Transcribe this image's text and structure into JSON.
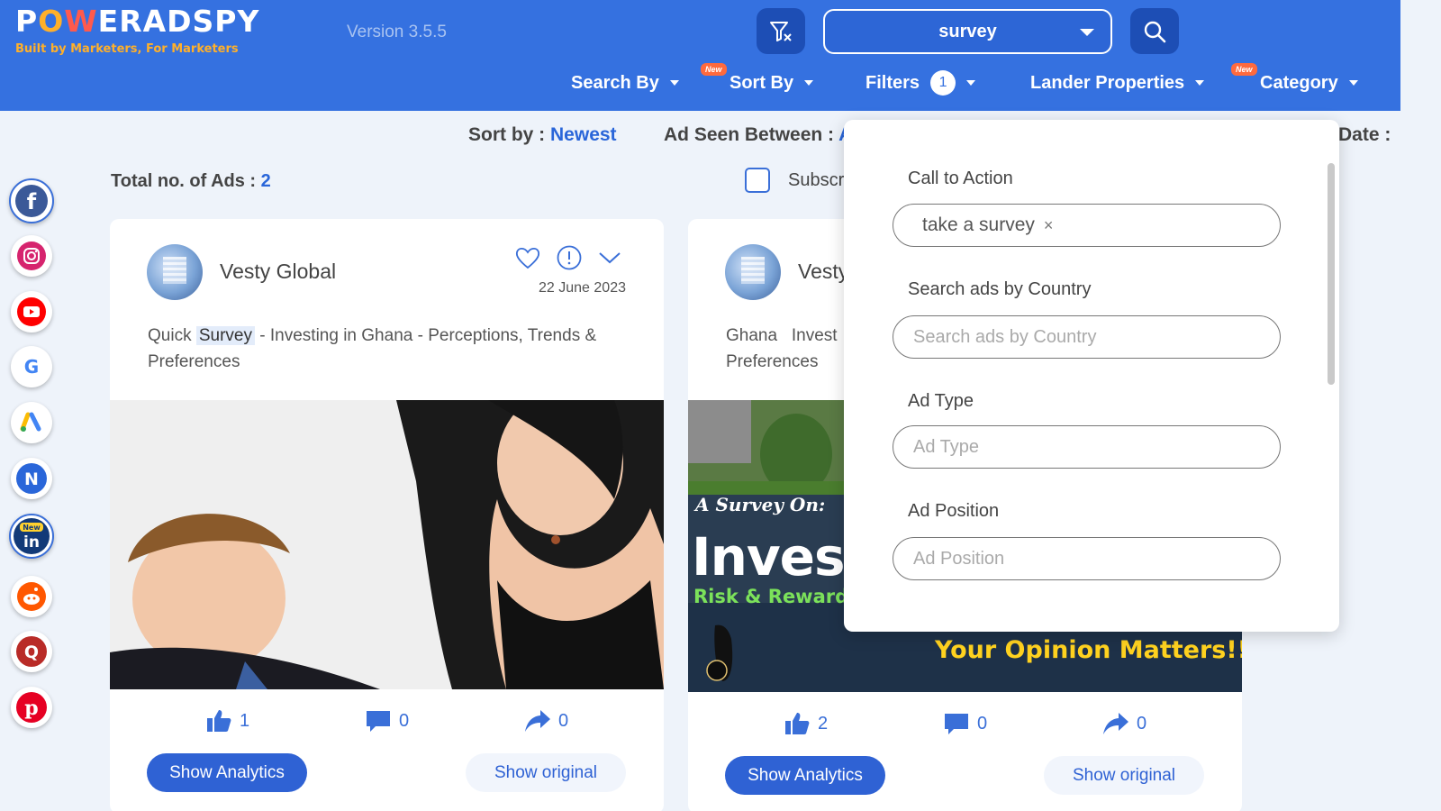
{
  "header": {
    "logo": {
      "power": "POWER",
      "adspy": "ADSPY",
      "tagline": "Built by Marketers, For Marketers"
    },
    "version": "Version 3.5.5",
    "search_value": "survey",
    "nav": {
      "search_by": "Search By",
      "sort_by": "Sort By",
      "sort_by_badge": "New",
      "filters": "Filters",
      "filters_count": "1",
      "lander_properties": "Lander Properties",
      "category": "Category",
      "category_badge": "New"
    }
  },
  "sortbar": {
    "sort_label": "Sort by :",
    "sort_value": "Newest",
    "seen_label": "Ad Seen Between :",
    "seen_value_partial": "A",
    "date_label_partial": "Date :"
  },
  "summary": {
    "total_label": "Total no. of Ads :",
    "total_value": "2",
    "subscribe_partial": "Subscr"
  },
  "social": [
    {
      "name": "facebook-icon",
      "color": "#3b5998",
      "letter": "f"
    },
    {
      "name": "instagram-icon",
      "color": "#e1306c",
      "letter": ""
    },
    {
      "name": "youtube-icon",
      "color": "#ff0000",
      "letter": ""
    },
    {
      "name": "google-icon",
      "color": "#4285f4",
      "letter": "G"
    },
    {
      "name": "google-ads-icon",
      "color": "#fbbc04",
      "letter": ""
    },
    {
      "name": "native-icon",
      "color": "#2a66d9",
      "letter": "N"
    },
    {
      "name": "linkedin-icon",
      "color": "#0a66c2",
      "letter": "in",
      "badge": "New"
    },
    {
      "name": "reddit-icon",
      "color": "#ff5700",
      "letter": ""
    },
    {
      "name": "quora-icon",
      "color": "#b92b27",
      "letter": "Q"
    },
    {
      "name": "pinterest-icon",
      "color": "#e60023",
      "letter": "P"
    }
  ],
  "cards": [
    {
      "advertiser": "Vesty Global",
      "date": "22 June 2023",
      "text_before": "Quick",
      "text_highlight": "Survey",
      "text_after": "- Investing in Ghana - Perceptions, Trends & Preferences",
      "likes": "1",
      "comments": "0",
      "shares": "0",
      "analytics_label": "Show Analytics",
      "original_label": "Show original"
    },
    {
      "advertiser": "Vesty",
      "text": "Ghana   Invest",
      "text_line2": "Preferences",
      "image_title": "A Survey On:",
      "image_big": "Inves",
      "image_sub": "Risk & Reward",
      "image_banner": "Your Opinion Matters!!",
      "likes": "2",
      "comments": "0",
      "shares": "0",
      "analytics_label": "Show Analytics",
      "original_label": "Show original"
    }
  ],
  "panel": {
    "cta_label": "Call to Action",
    "cta_tag": "take a survey",
    "cta_tag_remove": "×",
    "country_label": "Search ads by Country",
    "country_placeholder": "Search ads by Country",
    "adtype_label": "Ad Type",
    "adtype_placeholder": "Ad Type",
    "adpos_label": "Ad Position",
    "adpos_placeholder": "Ad Position"
  }
}
